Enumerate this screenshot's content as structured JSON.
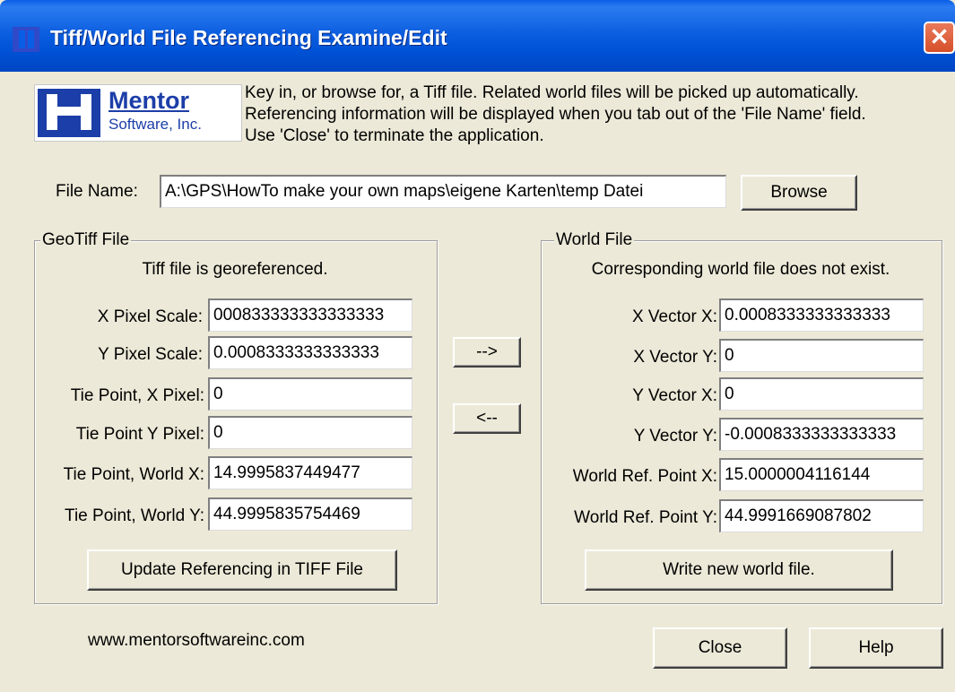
{
  "window": {
    "title": "Tiff/World File Referencing Examine/Edit",
    "close_glyph": "✕"
  },
  "logo": {
    "name": "Mentor",
    "sub": "Software, Inc."
  },
  "intro": [
    "Key in, or browse for, a Tiff file.  Related world files will be picked up automatically.",
    "Referencing information will be displayed when you tab out of the 'File Name' field.",
    "Use 'Close' to terminate the application."
  ],
  "file": {
    "label": "File Name:",
    "value": "A:\\GPS\\HowTo make your own maps\\eigene Karten\\temp Datei",
    "browse": "Browse"
  },
  "geotiff": {
    "title": "GeoTiff File",
    "status": "Tiff file is georeferenced.",
    "fields": [
      {
        "label": "X Pixel Scale:",
        "value": "000833333333333333"
      },
      {
        "label": "Y Pixel Scale:",
        "value": "0.0008333333333333"
      },
      {
        "label": "Tie Point, X Pixel:",
        "value": "0"
      },
      {
        "label": "Tie Point Y Pixel:",
        "value": "0"
      },
      {
        "label": "Tie Point, World X:",
        "value": "14.9995837449477"
      },
      {
        "label": "Tie Point, World Y:",
        "value": "44.9995835754469"
      }
    ],
    "update_button": "Update Referencing in TIFF File"
  },
  "transfer": {
    "to_world": "-->",
    "to_tiff": "<--"
  },
  "world": {
    "title": "World File",
    "status": "Corresponding world file does not exist.",
    "fields": [
      {
        "label": "X Vector X:",
        "value": "0.0008333333333333"
      },
      {
        "label": "X Vector Y:",
        "value": "0"
      },
      {
        "label": "Y Vector X:",
        "value": "0"
      },
      {
        "label": "Y Vector Y:",
        "value": "-0.0008333333333333"
      },
      {
        "label": "World Ref. Point X:",
        "value": "15.0000004116144"
      },
      {
        "label": "World Ref. Point Y:",
        "value": "44.9991669087802"
      }
    ],
    "write_button": "Write new world file."
  },
  "footer": {
    "url": "www.mentorsoftwareinc.com",
    "close": "Close",
    "help": "Help"
  }
}
